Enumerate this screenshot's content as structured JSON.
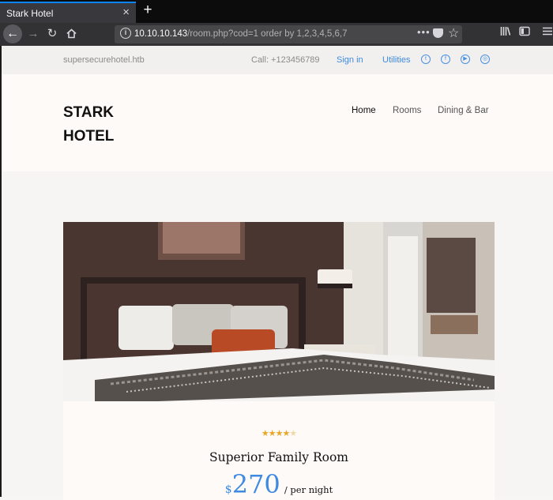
{
  "browser": {
    "tab_title": "Stark Hotel",
    "tab_close": "×",
    "new_tab": "+",
    "url_host": "10.10.10.143",
    "url_path": "/room.php?cod=1 order by 1,2,3,4,5,6,7",
    "icons": [
      "back-icon",
      "forward-icon",
      "reload-icon",
      "home-icon",
      "info-icon",
      "page-actions-icon",
      "pocket-icon",
      "bookmark-star-icon",
      "library-icon",
      "sidebar-icon",
      "menu-icon"
    ]
  },
  "topbar": {
    "site": "supersecurehotel.htb",
    "call": "Call: +123456789",
    "sign_in": "Sign in",
    "utilities": "Utilities",
    "social_icons": [
      "twitter-icon",
      "facebook-icon",
      "youtube-icon",
      "instagram-icon"
    ]
  },
  "header": {
    "logo_line1": "STARK",
    "logo_line2": "HOTEL",
    "nav": [
      "Home",
      "Rooms",
      "Dining & Bar"
    ]
  },
  "room": {
    "rating_stars": 4,
    "rating_max": 5,
    "title": "Superior Family Room",
    "currency": "$",
    "price": "270",
    "per_night": "/ per night"
  },
  "colors": {
    "accent": "#3d8ae0",
    "star": "#e8a72a",
    "tab_highlight": "#0a84ff"
  }
}
